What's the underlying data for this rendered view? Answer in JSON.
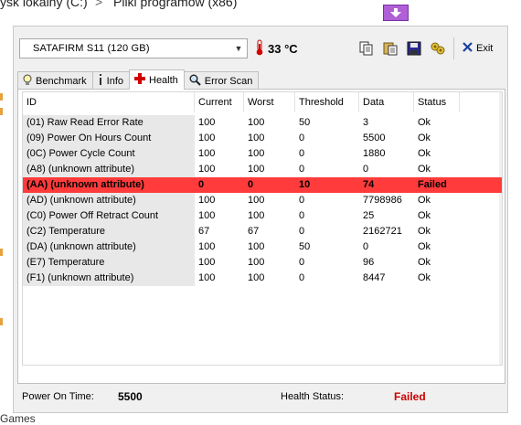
{
  "background": {
    "path_left": "ysk lokalny (C:)",
    "path_sep": ">",
    "path_right": "Pliki programów (x86)",
    "bottom_text": "Games"
  },
  "toolbar": {
    "device": "SATAFIRM   S11 (120 GB)",
    "temperature": "33 °C",
    "exit_label": "Exit"
  },
  "tabs": [
    {
      "label": "Benchmark",
      "icon": "lightbulb-icon"
    },
    {
      "label": "Info",
      "icon": "info-icon"
    },
    {
      "label": "Health",
      "icon": "health-cross-icon",
      "active": true
    },
    {
      "label": "Error Scan",
      "icon": "magnifier-icon"
    }
  ],
  "table": {
    "headers": [
      "ID",
      "Current",
      "Worst",
      "Threshold",
      "Data",
      "Status"
    ],
    "rows": [
      {
        "id": "(01) Raw Read Error Rate",
        "current": "100",
        "worst": "100",
        "threshold": "50",
        "data": "3",
        "status": "Ok"
      },
      {
        "id": "(09) Power On Hours Count",
        "current": "100",
        "worst": "100",
        "threshold": "0",
        "data": "5500",
        "status": "Ok"
      },
      {
        "id": "(0C) Power Cycle Count",
        "current": "100",
        "worst": "100",
        "threshold": "0",
        "data": "1880",
        "status": "Ok"
      },
      {
        "id": "(A8) (unknown attribute)",
        "current": "100",
        "worst": "100",
        "threshold": "0",
        "data": "0",
        "status": "Ok"
      },
      {
        "id": "(AA) (unknown attribute)",
        "current": "0",
        "worst": "0",
        "threshold": "10",
        "data": "74",
        "status": "Failed",
        "failed": true
      },
      {
        "id": "(AD) (unknown attribute)",
        "current": "100",
        "worst": "100",
        "threshold": "0",
        "data": "7798986",
        "status": "Ok"
      },
      {
        "id": "(C0) Power Off Retract Count",
        "current": "100",
        "worst": "100",
        "threshold": "0",
        "data": "25",
        "status": "Ok"
      },
      {
        "id": "(C2) Temperature",
        "current": "67",
        "worst": "67",
        "threshold": "0",
        "data": "2162721",
        "status": "Ok"
      },
      {
        "id": "(DA) (unknown attribute)",
        "current": "100",
        "worst": "100",
        "threshold": "50",
        "data": "0",
        "status": "Ok"
      },
      {
        "id": "(E7) Temperature",
        "current": "100",
        "worst": "100",
        "threshold": "0",
        "data": "96",
        "status": "Ok"
      },
      {
        "id": "(F1) (unknown attribute)",
        "current": "100",
        "worst": "100",
        "threshold": "0",
        "data": "8447",
        "status": "Ok"
      }
    ]
  },
  "footer": {
    "power_on_label": "Power On Time:",
    "power_on_value": "5500",
    "health_label": "Health Status:",
    "health_value": "Failed",
    "health_color": "#cc0000"
  },
  "colors": {
    "failed_row": "#ff3b3b",
    "id_cell": "#e8e8e8"
  }
}
